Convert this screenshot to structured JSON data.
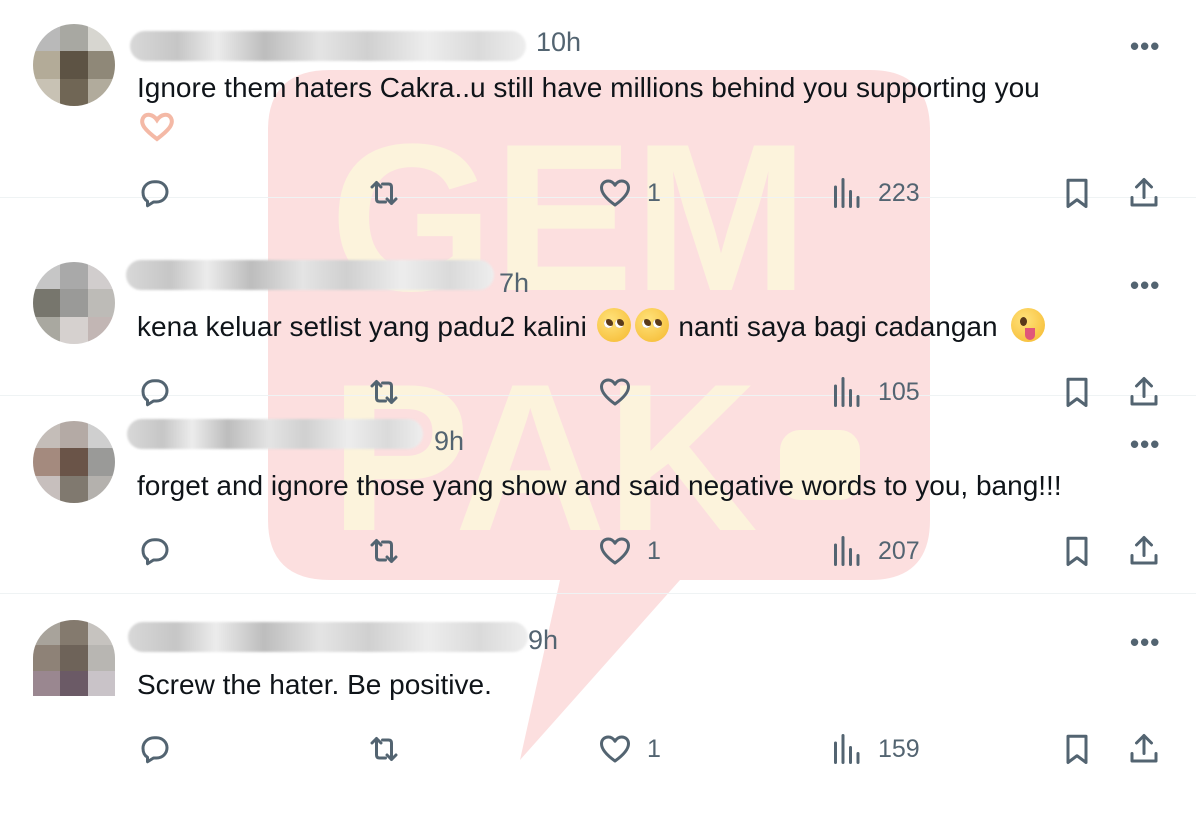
{
  "tweets": [
    {
      "time": "10h",
      "text": "Ignore them haters Cakra..u still have millions behind you supporting you",
      "likes": "1",
      "views": "223"
    },
    {
      "time": "7h",
      "text_before": "kena keluar setlist yang padu2 kalini",
      "text_after": "nanti saya bagi cadangan",
      "likes": "",
      "views": "105"
    },
    {
      "time": "9h",
      "text": "forget and ignore those yang show and said negative words to you, bang!!!",
      "likes": "1",
      "views": "207"
    },
    {
      "time": "9h",
      "text": "Screw the hater. Be positive.",
      "likes": "1",
      "views": "159"
    }
  ],
  "more_label": "•••",
  "watermark": {
    "text": "GEMPAK",
    "color": "#f7c6c6"
  },
  "colors": {
    "secondary_text": "#536471",
    "primary_text": "#0f1419",
    "divider": "#eff3f4"
  }
}
